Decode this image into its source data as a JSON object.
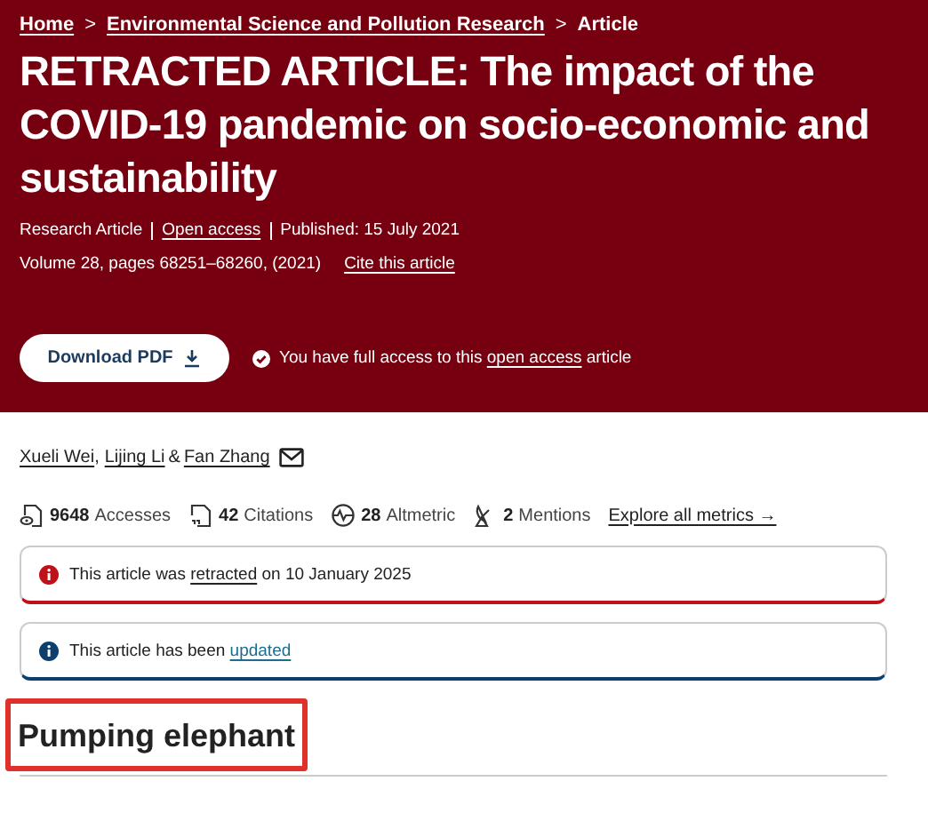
{
  "breadcrumb": [
    {
      "label": "Home"
    },
    {
      "label": "Environmental Science and Pollution Research"
    },
    {
      "label": "Article"
    }
  ],
  "breadcrumb_separator": ">",
  "title": "RETRACTED ARTICLE: The impact of the COVID-19 pandemic on socio-economic and sustainability",
  "meta": {
    "type": "Research Article",
    "access": "Open access",
    "published": "Published: 15 July 2021",
    "volume": "Volume 28, pages 68251–68260, (2021)",
    "cite": "Cite this article"
  },
  "download_button": "Download PDF",
  "access_note": {
    "before": "You have full access to this ",
    "link": "open access",
    "after": " article"
  },
  "authors": [
    {
      "name": "Xueli Wei",
      "sep": ","
    },
    {
      "name": "Lijing Li",
      "sep": "&"
    },
    {
      "name": "Fan Zhang"
    }
  ],
  "metrics": [
    {
      "kind": "accesses",
      "value": "9648",
      "label": "Accesses"
    },
    {
      "kind": "citations",
      "value": "42",
      "label": "Citations"
    },
    {
      "kind": "altmetric",
      "value": "28",
      "label": "Altmetric"
    },
    {
      "kind": "mentions",
      "value": "2",
      "label": "Mentions"
    }
  ],
  "metrics_link": "Explore all metrics →",
  "notices": [
    {
      "color": "#c0101a",
      "before": "This article was ",
      "link": "retracted",
      "after": " on 10 January 2025"
    },
    {
      "color": "#0c3f6e",
      "before": "This article has been ",
      "link": "updated"
    }
  ],
  "section_heading": {
    "text": "Pumping elephant",
    "highlighted": true
  }
}
